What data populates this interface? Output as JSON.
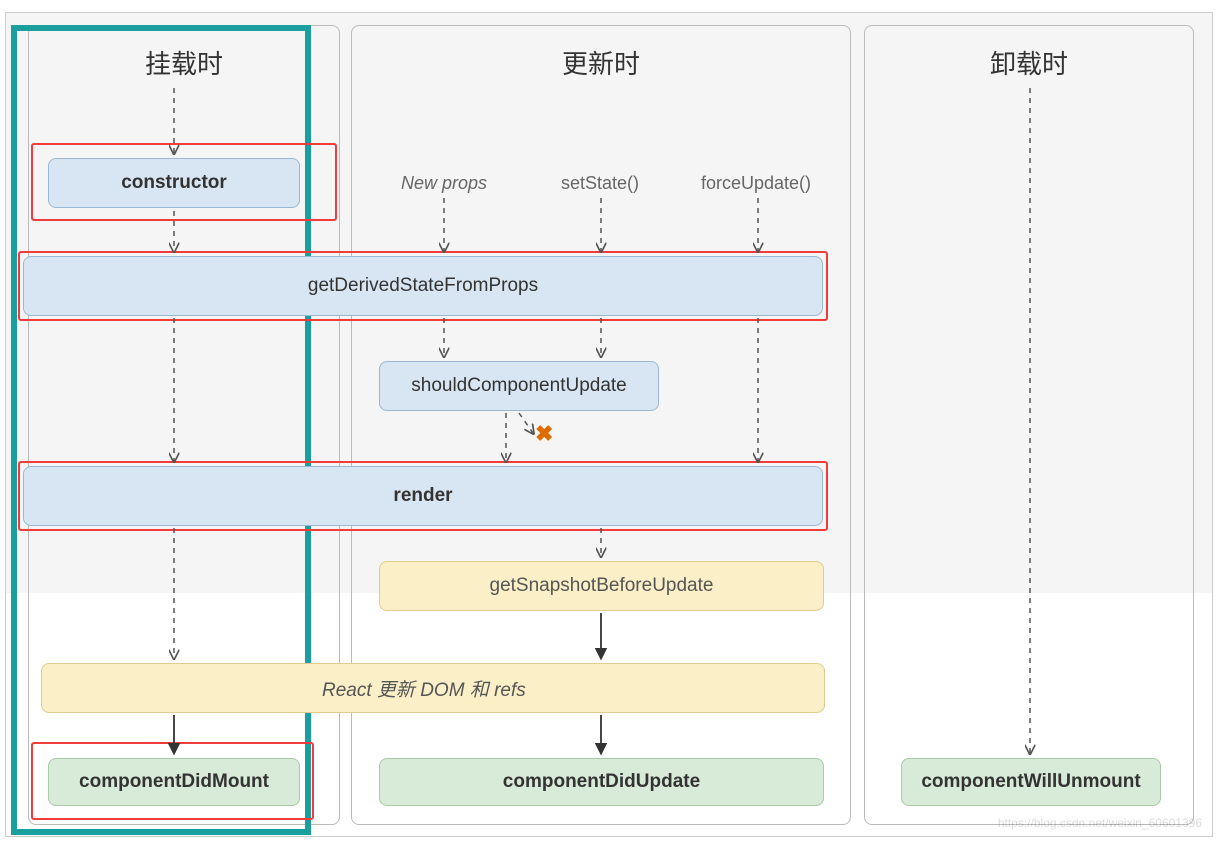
{
  "columns": {
    "mount": {
      "title": "挂载时"
    },
    "update": {
      "title": "更新时"
    },
    "unmount": {
      "title": "卸载时"
    }
  },
  "triggers": {
    "new_props": "New props",
    "set_state": "setState()",
    "force_update": "forceUpdate()"
  },
  "lifecycle": {
    "constructor": "constructor",
    "gdsfp": "getDerivedStateFromProps",
    "scu": "shouldComponentUpdate",
    "render": "render",
    "gsbu": "getSnapshotBeforeUpdate",
    "react_update": "React 更新 DOM 和 refs",
    "cdm": "componentDidMount",
    "cdu": "componentDidUpdate",
    "cwu": "componentWillUnmount"
  },
  "marks": {
    "x": "✖"
  },
  "watermark": "https://blog.csdn.net/weixin_60601396"
}
